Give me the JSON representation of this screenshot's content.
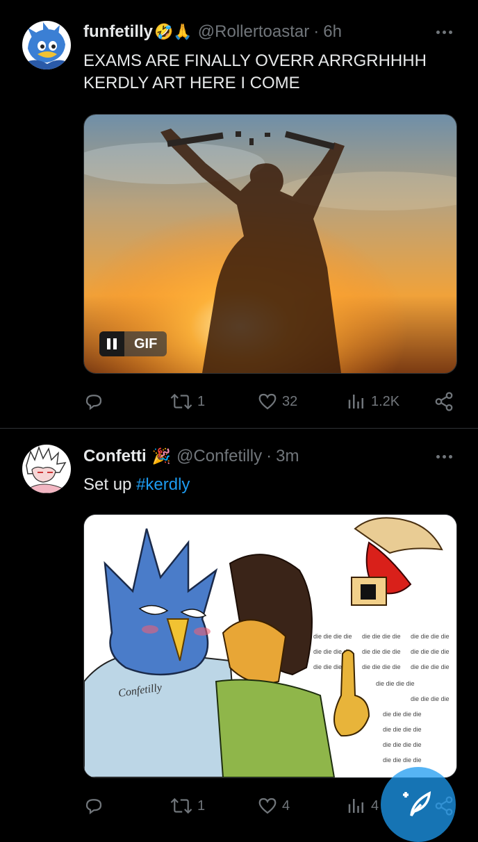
{
  "tweets": [
    {
      "name": "funfetilly",
      "emojis": "🤣🙏",
      "handle": "@Rollertoastar",
      "separator": "·",
      "time": "6h",
      "text_line1": "EXAMS ARE FINALLY OVERR ARRGRHHHH",
      "text_line2": "KERDLY ART HERE I COME",
      "media_badge": "GIF",
      "actions": {
        "reply": "",
        "retweets": "1",
        "likes": "32",
        "views": "1.2K"
      }
    },
    {
      "name": "Confetti",
      "emojis": "🎉",
      "handle": "@Confetilly",
      "separator": "·",
      "time": "3m",
      "text_prefix": "Set up ",
      "hashtag": "#kerdly",
      "media_signature": "Confetilly",
      "media_text": "die die die die",
      "actions": {
        "reply": "",
        "retweets": "1",
        "likes": "4",
        "views": "4"
      }
    }
  ],
  "colors": {
    "background": "#000000",
    "accent": "#1d9bf0",
    "muted": "#71767b",
    "text": "#e7e9ea"
  },
  "icons": [
    "more-icon",
    "reply-icon",
    "retweet-icon",
    "like-icon",
    "views-icon",
    "share-icon",
    "compose-icon"
  ]
}
